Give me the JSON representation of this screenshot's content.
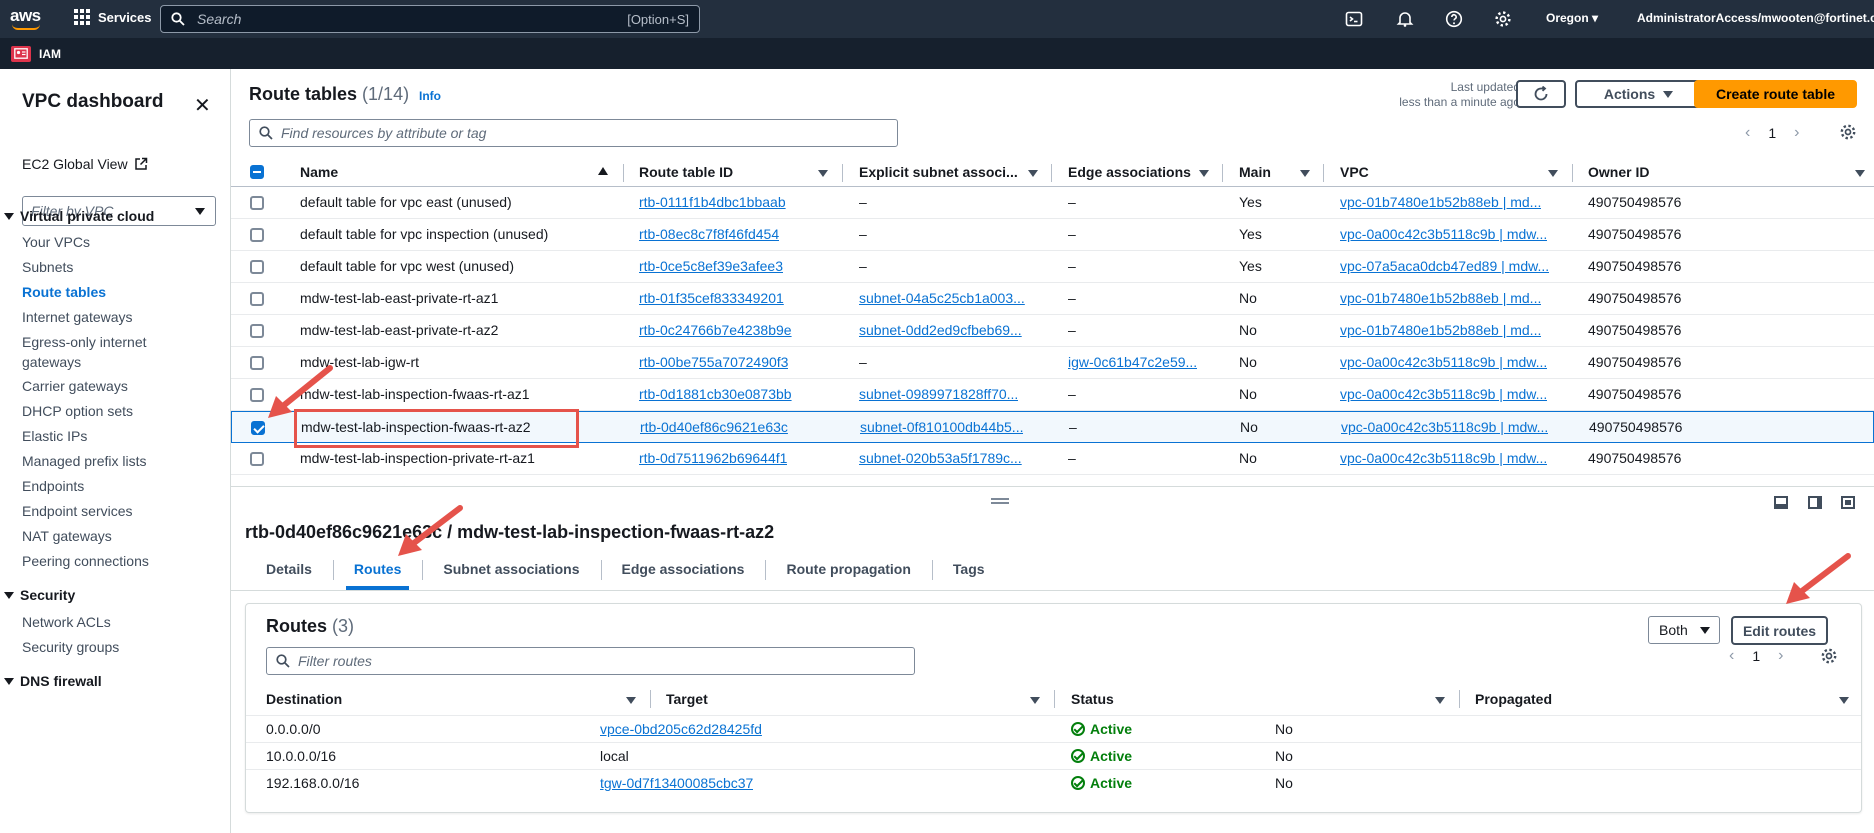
{
  "topnav": {
    "logo_text": "aws",
    "services_label": "Services",
    "search_placeholder": "Search",
    "search_shortcut": "[Option+S]",
    "region": "Oregon",
    "account": "AdministratorAccess/mwooten@fortinet.co"
  },
  "subnav": {
    "label": "IAM"
  },
  "sidebar": {
    "title": "VPC dashboard",
    "ec2_global_view": "EC2 Global View",
    "filter_placeholder": "Filter by VPC",
    "sections": [
      {
        "label": "Virtual private cloud"
      },
      {
        "label": "Security"
      },
      {
        "label": "DNS firewall"
      }
    ],
    "items": [
      "Your VPCs",
      "Subnets",
      "Route tables",
      "Internet gateways",
      "Egress-only internet gateways",
      "Carrier gateways",
      "DHCP option sets",
      "Elastic IPs",
      "Managed prefix lists",
      "Endpoints",
      "Endpoint services",
      "NAT gateways",
      "Peering connections"
    ],
    "security_items": [
      "Network ACLs",
      "Security groups"
    ],
    "active_item": "Route tables"
  },
  "main": {
    "title": "Route tables",
    "count": "(1/14)",
    "info": "Info",
    "last_updated_line1": "Last updated",
    "last_updated_line2": "less than a minute ago",
    "actions_label": "Actions",
    "create_label": "Create route table",
    "find_placeholder": "Find resources by attribute or tag",
    "page": "1"
  },
  "table": {
    "columns": [
      "Name",
      "Route table ID",
      "Explicit subnet associ...",
      "Edge associations",
      "Main",
      "VPC",
      "Owner ID"
    ],
    "rows": [
      {
        "name": "default table for vpc east (unused)",
        "id": "rtb-0111f1b4dbc1bbaab",
        "subnet": "–",
        "edge": "–",
        "main": "Yes",
        "vpc": "vpc-01b7480e1b52b88eb | md...",
        "owner": "490750498576",
        "selected": false
      },
      {
        "name": "default table for vpc inspection (unused)",
        "id": "rtb-08ec8c7f8f46fd454",
        "subnet": "–",
        "edge": "–",
        "main": "Yes",
        "vpc": "vpc-0a00c42c3b5118c9b | mdw...",
        "owner": "490750498576",
        "selected": false
      },
      {
        "name": "default table for vpc west (unused)",
        "id": "rtb-0ce5c8ef39e3afee3",
        "subnet": "–",
        "edge": "–",
        "main": "Yes",
        "vpc": "vpc-07a5aca0dcb47ed89 | mdw...",
        "owner": "490750498576",
        "selected": false
      },
      {
        "name": "mdw-test-lab-east-private-rt-az1",
        "id": "rtb-01f35cef833349201",
        "subnet": "subnet-04a5c25cb1a003...",
        "edge": "–",
        "main": "No",
        "vpc": "vpc-01b7480e1b52b88eb | md...",
        "owner": "490750498576",
        "selected": false
      },
      {
        "name": "mdw-test-lab-east-private-rt-az2",
        "id": "rtb-0c24766b7e4238b9e",
        "subnet": "subnet-0dd2ed9cfbeb69...",
        "edge": "–",
        "main": "No",
        "vpc": "vpc-01b7480e1b52b88eb | md...",
        "owner": "490750498576",
        "selected": false
      },
      {
        "name": "mdw-test-lab-igw-rt",
        "id": "rtb-00be755a7072490f3",
        "subnet": "–",
        "edge": "igw-0c61b47c2e59...",
        "main": "No",
        "vpc": "vpc-0a00c42c3b5118c9b | mdw...",
        "owner": "490750498576",
        "selected": false
      },
      {
        "name": "mdw-test-lab-inspection-fwaas-rt-az1",
        "id": "rtb-0d1881cb30e0873bb",
        "subnet": "subnet-0989971828ff70...",
        "edge": "–",
        "main": "No",
        "vpc": "vpc-0a00c42c3b5118c9b | mdw...",
        "owner": "490750498576",
        "selected": false
      },
      {
        "name": "mdw-test-lab-inspection-fwaas-rt-az2",
        "id": "rtb-0d40ef86c9621e63c",
        "subnet": "subnet-0f810100db44b5...",
        "edge": "–",
        "main": "No",
        "vpc": "vpc-0a00c42c3b5118c9b | mdw...",
        "owner": "490750498576",
        "selected": true
      },
      {
        "name": "mdw-test-lab-inspection-private-rt-az1",
        "id": "rtb-0d7511962b69644f1",
        "subnet": "subnet-020b53a5f1789c...",
        "edge": "–",
        "main": "No",
        "vpc": "vpc-0a00c42c3b5118c9b | mdw...",
        "owner": "490750498576",
        "selected": false
      }
    ]
  },
  "detail": {
    "title": "rtb-0d40ef86c9621e63c / mdw-test-lab-inspection-fwaas-rt-az2",
    "tabs": [
      "Details",
      "Routes",
      "Subnet associations",
      "Edge associations",
      "Route propagation",
      "Tags"
    ],
    "active_tab": "Routes",
    "routes_title": "Routes",
    "routes_count": "(3)",
    "both_label": "Both",
    "edit_routes_label": "Edit routes",
    "filter_placeholder": "Filter routes",
    "page": "1",
    "columns": [
      "Destination",
      "Target",
      "Status",
      "Propagated"
    ],
    "routes": [
      {
        "destination": "0.0.0.0/0",
        "target": "vpce-0bd205c62d28425fd",
        "target_link": true,
        "status": "Active",
        "propagated": "No"
      },
      {
        "destination": "10.0.0.0/16",
        "target": "local",
        "target_link": false,
        "status": "Active",
        "propagated": "No"
      },
      {
        "destination": "192.168.0.0/16",
        "target": "tgw-0d7f13400085cbc37",
        "target_link": true,
        "status": "Active",
        "propagated": "No"
      }
    ]
  },
  "colors": {
    "nav": "#232f3e",
    "link": "#0972d3",
    "primary": "#ff9900",
    "active": "#037f0c",
    "annotation": "#e5534b"
  }
}
